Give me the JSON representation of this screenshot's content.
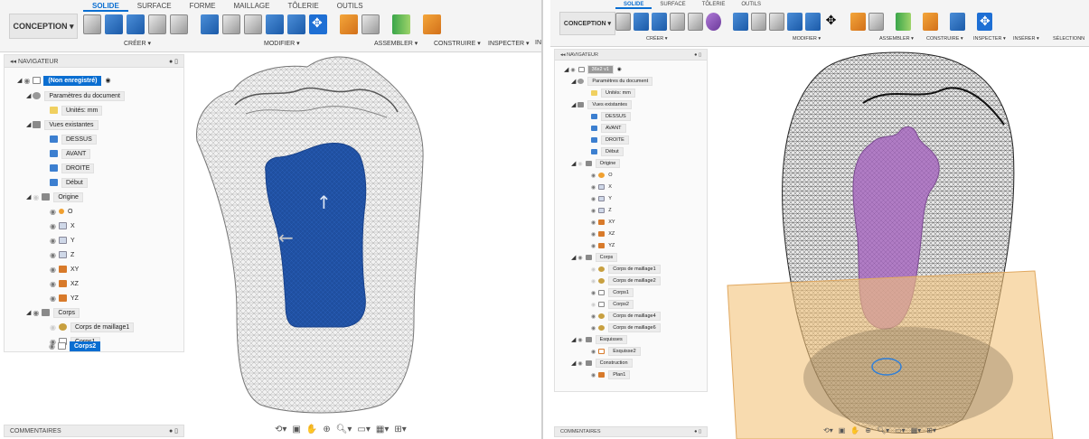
{
  "left": {
    "conception_label": "CONCEPTION ▾",
    "tabs": [
      "SOLIDE",
      "SURFACE",
      "FORME",
      "MAILLAGE",
      "TÔLERIE",
      "OUTILS"
    ],
    "groups": [
      "CRÉER ▾",
      "MODIFIER ▾",
      "ASSEMBLER ▾",
      "CONSTRUIRE ▾",
      "INSPECTER ▾",
      "IN"
    ],
    "navigator_title": "NAVIGATEUR",
    "comments_label": "COMMENTAIRES",
    "tree": [
      {
        "label": "(Non enregistré)"
      },
      {
        "label": "Paramètres du document"
      },
      {
        "label": "Unités: mm"
      },
      {
        "label": "Vues existantes"
      },
      {
        "label": "DESSUS"
      },
      {
        "label": "AVANT"
      },
      {
        "label": "DROITE"
      },
      {
        "label": "Début"
      },
      {
        "label": "Origine"
      },
      {
        "label": "O"
      },
      {
        "label": "X"
      },
      {
        "label": "Y"
      },
      {
        "label": "Z"
      },
      {
        "label": "XY"
      },
      {
        "label": "XZ"
      },
      {
        "label": "YZ"
      },
      {
        "label": "Corps"
      },
      {
        "label": "Corps de maillage1"
      },
      {
        "label": "Corps1"
      },
      {
        "label": "Corps2"
      }
    ]
  },
  "right": {
    "conception_label": "CONCEPTION ▾",
    "tabs": [
      "SOLIDE",
      "SURFACE",
      "TÔLERIE",
      "OUTILS"
    ],
    "groups": [
      "CRÉER ▾",
      "MODIFIER ▾",
      "ASSEMBLER ▾",
      "CONSTRUIRE ▾",
      "INSPECTER ▾",
      "INSÉRER ▾",
      "SÉLECTIONN"
    ],
    "navigator_title": "NAVIGATEUR",
    "comments_label": "COMMENTAIRES",
    "tree": [
      {
        "label": "36x2 v1"
      },
      {
        "label": "Paramètres du document"
      },
      {
        "label": "Unités: mm"
      },
      {
        "label": "Vues existantes"
      },
      {
        "label": "DESSUS"
      },
      {
        "label": "AVANT"
      },
      {
        "label": "DROITE"
      },
      {
        "label": "Début"
      },
      {
        "label": "Origine"
      },
      {
        "label": "O"
      },
      {
        "label": "X"
      },
      {
        "label": "Y"
      },
      {
        "label": "Z"
      },
      {
        "label": "XY"
      },
      {
        "label": "XZ"
      },
      {
        "label": "YZ"
      },
      {
        "label": "Corps"
      },
      {
        "label": "Corps de maillage1"
      },
      {
        "label": "Corps de maillage2"
      },
      {
        "label": "Corps1"
      },
      {
        "label": "Corps2"
      },
      {
        "label": "Corps de maillage4"
      },
      {
        "label": "Corps de maillage6"
      },
      {
        "label": "Esquisses"
      },
      {
        "label": "Esquisse2"
      },
      {
        "label": "Construction"
      },
      {
        "label": "Plan1"
      }
    ]
  },
  "colors": {
    "accent": "#0a6ed1",
    "mesh": "#b8b8b8",
    "selection_blue": "#1f4fa0",
    "purple_body": "#b07cc4",
    "plane_orange": "#f3c37a"
  },
  "icons": [
    "eye-icon",
    "folder-icon",
    "gear-icon",
    "view-icon",
    "plane-icon",
    "mesh-body-icon",
    "body-icon",
    "origin-icon",
    "sketch-icon",
    "orbit-icon",
    "pan-icon",
    "zoom-icon",
    "display-icon",
    "grid-icon"
  ]
}
